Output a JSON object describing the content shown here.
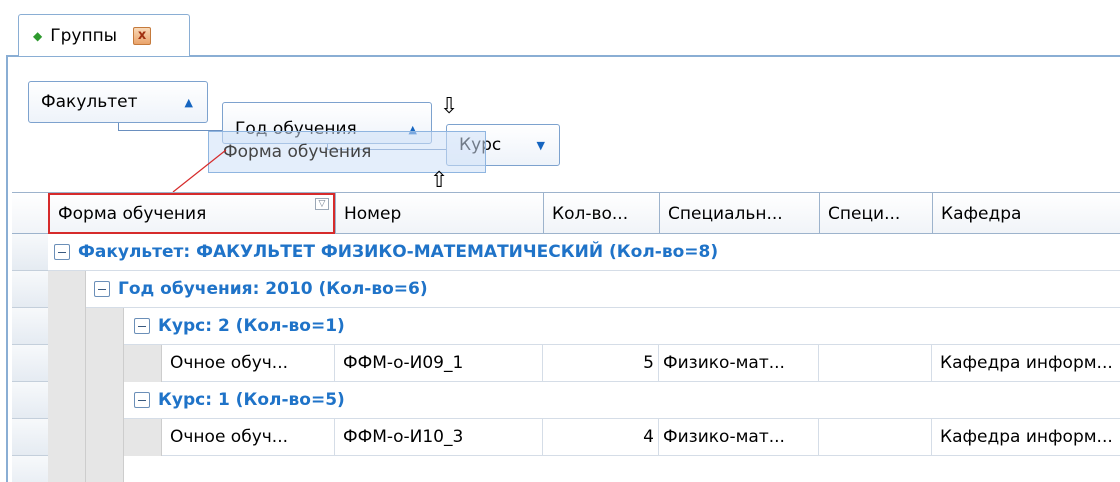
{
  "tab": {
    "title": "Группы",
    "icon": "diamond-icon",
    "close_label": "x"
  },
  "group_panel": {
    "buttons": [
      {
        "label": "Факультет",
        "sort": "ascending"
      },
      {
        "label": "Год обучения",
        "sort": "ascending"
      },
      {
        "label": "Курс",
        "sort": "descending"
      }
    ],
    "dragging_label": "Форма обучения"
  },
  "grid": {
    "columns": [
      "Форма обучения",
      "Номер",
      "Кол-во...",
      "Специальн...",
      "Специ...",
      "Кафедра"
    ],
    "groups": {
      "level1": "Факультет: ФАКУЛЬТЕТ ФИЗИКО-МАТЕМАТИЧЕСКИЙ (Кол-во=8)",
      "level2": "Год обучения: 2010 (Кол-во=6)",
      "level3a": "Курс: 2 (Кол-во=1)",
      "level3b": "Курс: 1 (Кол-во=5)"
    },
    "rows": [
      {
        "form": "Очное обуч...",
        "number": "ФФМ-о-И09_1",
        "count": "5",
        "spec": "Физико-мат...",
        "spec2": "",
        "dept": "Кафедра информ..."
      },
      {
        "form": "Очное обуч...",
        "number": "ФФМ-о-И10_3",
        "count": "4",
        "spec": "Физико-мат...",
        "spec2": "",
        "dept": "Кафедра информ..."
      }
    ]
  },
  "colors": {
    "accent": "#1f73c8",
    "border": "#8aaed4",
    "active_header_border": "#d62b2b"
  }
}
